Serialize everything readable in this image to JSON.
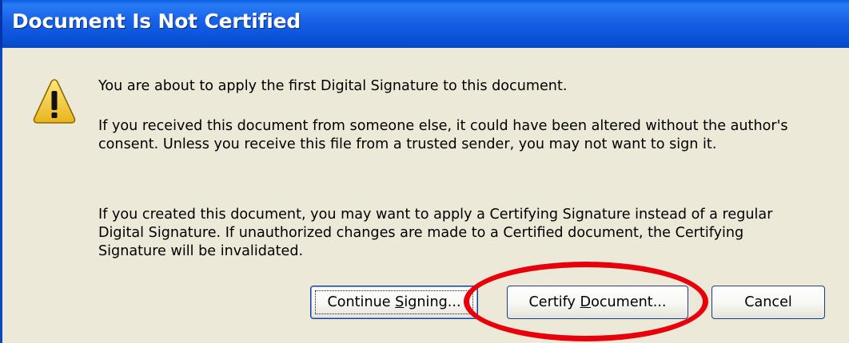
{
  "dialog": {
    "title": "Document Is Not Certified",
    "icon": "warning-icon",
    "message_intro": "You are about to apply the first Digital Signature to this document.",
    "message_warning": "If you received this document from someone else, it could have been altered without the author's consent. Unless you receive this file from a trusted sender, you may not want to sign it.",
    "message_certify": "If you created this document, you may want to apply a Certifying Signature instead of a regular Digital Signature. If unauthorized changes are made to a Certified document, the Certifying Signature will be invalidated."
  },
  "buttons": {
    "continue": {
      "before": "Continue ",
      "mnemonic": "S",
      "after": "igning..."
    },
    "certify": {
      "before": "Certify ",
      "mnemonic": "D",
      "after": "ocument..."
    },
    "cancel": {
      "label": "Cancel"
    }
  },
  "colors": {
    "titlebar": "#0a52d9",
    "dialog_bg": "#ece9d8",
    "highlight": "#e8000b",
    "warning_fill": "#f5cf3c"
  }
}
